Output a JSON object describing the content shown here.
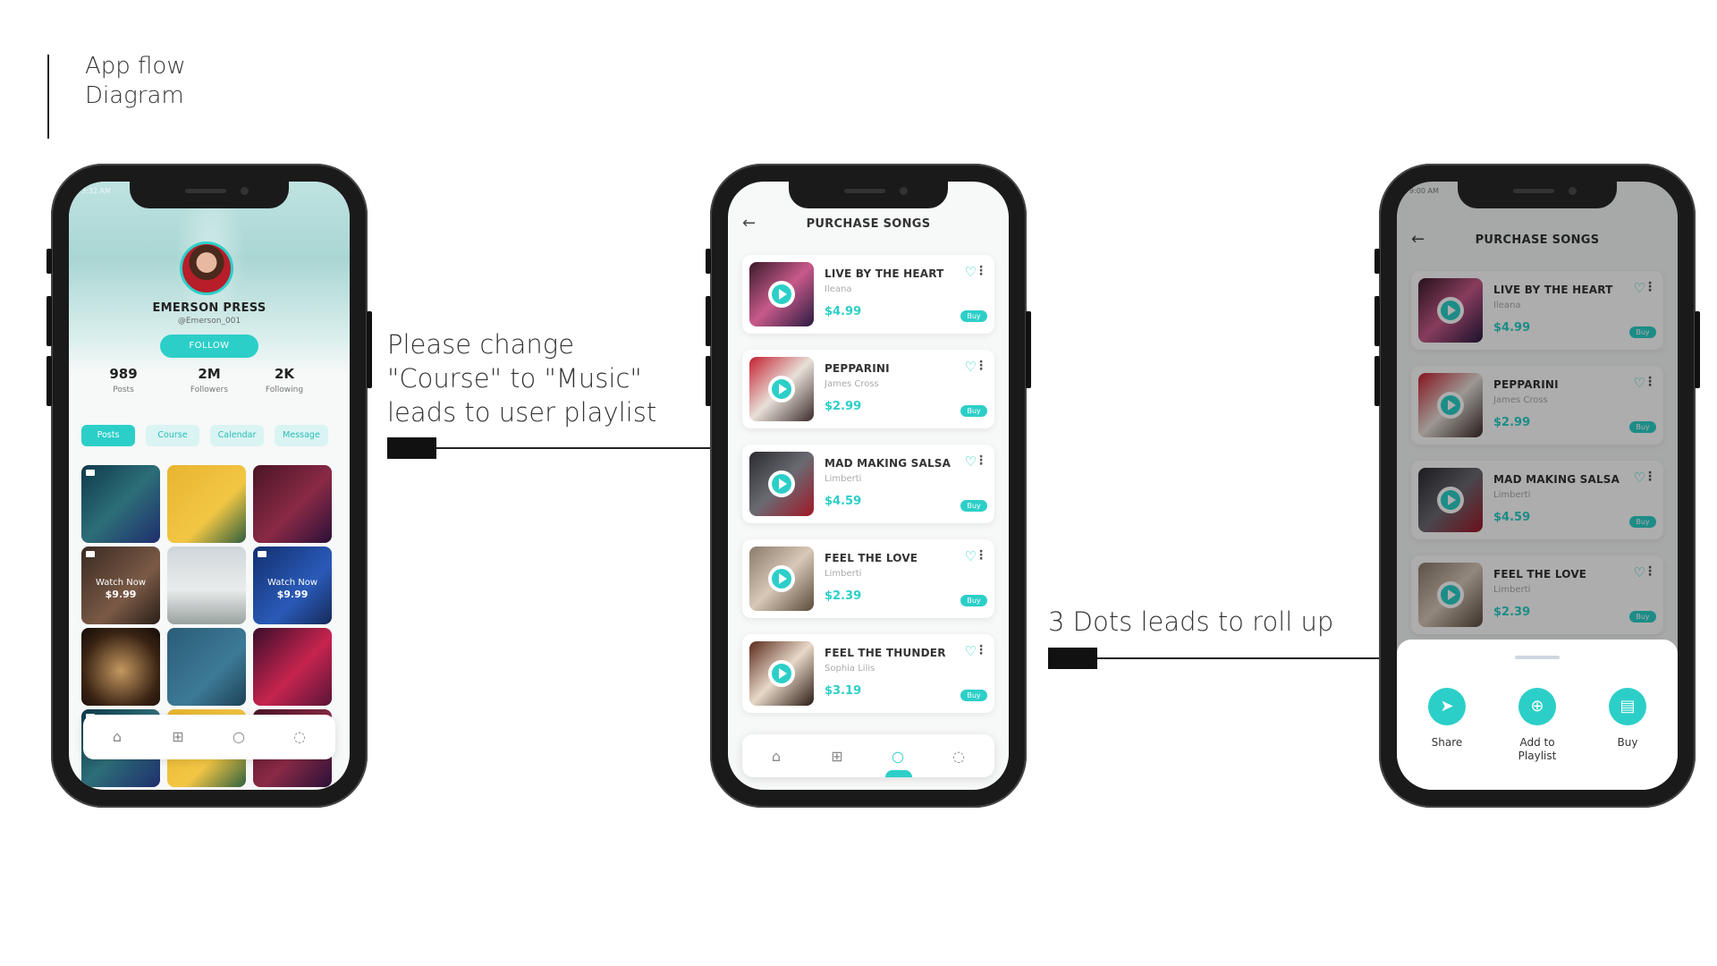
{
  "heading": "App flow\nDiagram",
  "notes": {
    "change_note": "Please change\n\"Course\" to \"Music\"\nleads to user playlist",
    "dots_note": "3 Dots leads to roll up"
  },
  "profile_screen": {
    "status_time": "3:32 AM",
    "name": "EMERSON PRESS",
    "username": "@Emerson_001",
    "follow_label": "FOLLOW",
    "stats": [
      {
        "value": "989",
        "label": "Posts"
      },
      {
        "value": "2M",
        "label": "Followers"
      },
      {
        "value": "2K",
        "label": "Following"
      }
    ],
    "tabs": [
      "Posts",
      "Course",
      "Calendar",
      "Message"
    ],
    "active_tab": "Posts",
    "watch_now": [
      {
        "label": "Watch Now",
        "price": "$9.99"
      },
      {
        "label": "Watch Now",
        "price": "$9.99"
      }
    ],
    "tabbar_icons": [
      "home-icon",
      "add-icon",
      "search-icon",
      "chat-icon"
    ]
  },
  "purchase_screen": {
    "status_time": "9:00 AM",
    "title": "PURCHASE SONGS",
    "buy_label": "Buy",
    "songs": [
      {
        "title": "LIVE BY THE HEART",
        "artist": "Ileana",
        "price": "$4.99"
      },
      {
        "title": "PEPPARINI",
        "artist": "James Cross",
        "price": "$2.99"
      },
      {
        "title": "MAD MAKING SALSA",
        "artist": "Limberti",
        "price": "$4.59"
      },
      {
        "title": "FEEL THE LOVE",
        "artist": "Limberti",
        "price": "$2.39"
      },
      {
        "title": "FEEL THE THUNDER",
        "artist": "Sophia Lilis",
        "price": "$3.19"
      }
    ]
  },
  "rollup_sheet": {
    "actions": [
      {
        "label": "Share",
        "icon": "send-icon"
      },
      {
        "label": "Add to\nPlaylist",
        "icon": "playlist-add-icon"
      },
      {
        "label": "Buy",
        "icon": "cart-icon"
      }
    ]
  },
  "colors": {
    "accent": "#2ccfc8",
    "accent_light": "#d9f4f3",
    "dark": "#1a1a1a"
  }
}
